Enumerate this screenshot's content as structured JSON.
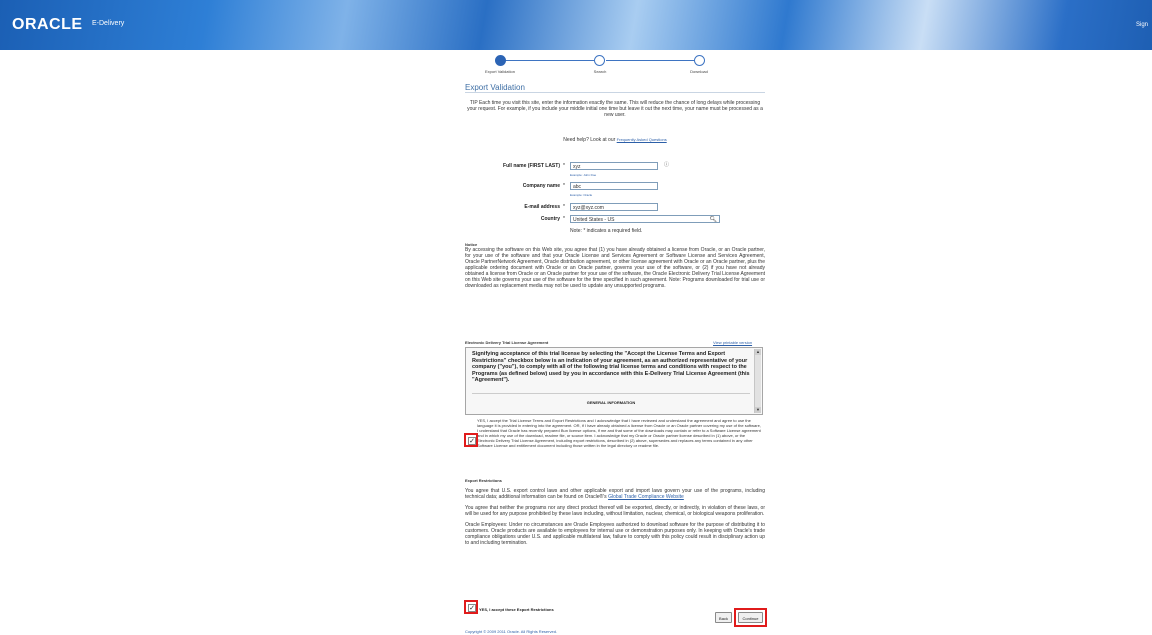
{
  "banner": {
    "logo": "ORACLE",
    "logo_sub": "E-Delivery",
    "sign_out": "Sign"
  },
  "train": {
    "steps": [
      {
        "label": "Export Validation",
        "state": "active"
      },
      {
        "label": "Search",
        "state": "inactive"
      },
      {
        "label": "Download",
        "state": "inactive"
      }
    ]
  },
  "page": {
    "title": "Export Validation",
    "tip": "TIP Each time you visit this site, enter the information exactly the same. This will reduce the chance of long delays while processing your request. For example, if you include your middle initial one time but leave it out the next time, your name must be processed as a new user.",
    "help_text": "Need help? Look at our",
    "help_link": "Frequently Asked Questions"
  },
  "form": {
    "full_name": {
      "label": "Full name (FIRST LAST)",
      "value": "xyz",
      "hint": "Example: John Doe"
    },
    "company": {
      "label": "Company name",
      "value": "abc",
      "hint": "Example: Oracle"
    },
    "email": {
      "label": "E-mail address",
      "value": "xyz@xyz.com"
    },
    "country": {
      "label": "Country",
      "value": "United States - US"
    },
    "required_mark": "*",
    "note": "Note:  * indicates a required field."
  },
  "notice": {
    "heading": "Notice",
    "text": "By accessing the software on this Web site, you agree that (1) you have already obtained a license from Oracle, or an Oracle partner, for your use of the software and that your Oracle License and Services Agreement or Software License and Services Agreement, Oracle PartnerNetwork Agreement, Oracle distribution agreement, or other license agreement with Oracle or an Oracle partner, plus the applicable ordering document with Oracle or an Oracle partner, governs your use of the software, or (2) if you have not already obtained a license from Oracle or an Oracle partner for your use of the software, the Oracle Electronic Delivery Trial License Agreement on this Web site governs your use of the software for the time specified in such agreement. Note: Programs downloaded for trial use or downloaded as replacement media may not be used to update any unsupported programs."
  },
  "license": {
    "heading": "Electronic Delivery Trial License Agreement",
    "print_link": "View printable version",
    "body": "Signifying acceptance of this trial license by selecting the \"Accept the License Terms and Export Restrictions\" checkbox below is an indication of your agreement, as an authorized representative of your company (\"you\"), to comply with all of the following trial license terms and conditions with respect to the Programs (as defined below) used by you in accordance with this E-Delivery Trial License Agreement (this \"Agreement\").",
    "general": "GENERAL INFORMATION",
    "accept_text": "YES, I accept the Trial License Terms and Export Restrictions and I acknowledge that I have reviewed and understand the agreement and agree to use the language it is provided in entering into the agreement. OR, if I have already obtained a license from Oracle or an Oracle partner covering my use of the software, I understand that Oracle has recently prepared Bun license options, if me and that some of the downloads may contain or refer to a Software License agreement and in which my use of the download, readme file, or source item. I acknowledge that my Oracle or Oracle partner license described in (1) above, or the Electronic Delivery Trial License Agreement, including export restrictions, described in (2) above, supersedes and replaces any terms contained in any other Software License and entitlement document including those written in the legal directory or readme file.",
    "checked": true
  },
  "export": {
    "heading": "Export Restrictions",
    "p1": "You agree that U.S. export control laws and other applicable export and import laws govern your use of the programs, including technical data; additional information can be found on Oracle®'s",
    "p1_link": "Global Trade Compliance Website",
    "p2": "You agree that neither the programs nor any direct product thereof will be exported, directly, or indirectly, in violation of these laws, or will be used for any purpose prohibited by these laws including, without limitation, nuclear, chemical, or biological weapons proliferation.",
    "p3": "Oracle Employees: Under no circumstances are Oracle Employees authorized to download software for the purpose of distributing it to customers. Oracle products are available to employees for internal use or demonstration purposes only. In keeping with Oracle's trade compliance obligations under U.S. and applicable multilateral law, failure to comply with this policy could result in disciplinary action up to and including termination.",
    "accept_label": "YES, I accept these Export Restrictions",
    "checked": true
  },
  "buttons": {
    "back": "Back",
    "continue": "Continue"
  },
  "footer": {
    "copyright": "Copyright © 2009 2011 Oracle. All Rights Reserved."
  },
  "colors": {
    "banner": "#2e7fd6",
    "link": "#2c5fa8",
    "highlight": "#e01b1b"
  }
}
